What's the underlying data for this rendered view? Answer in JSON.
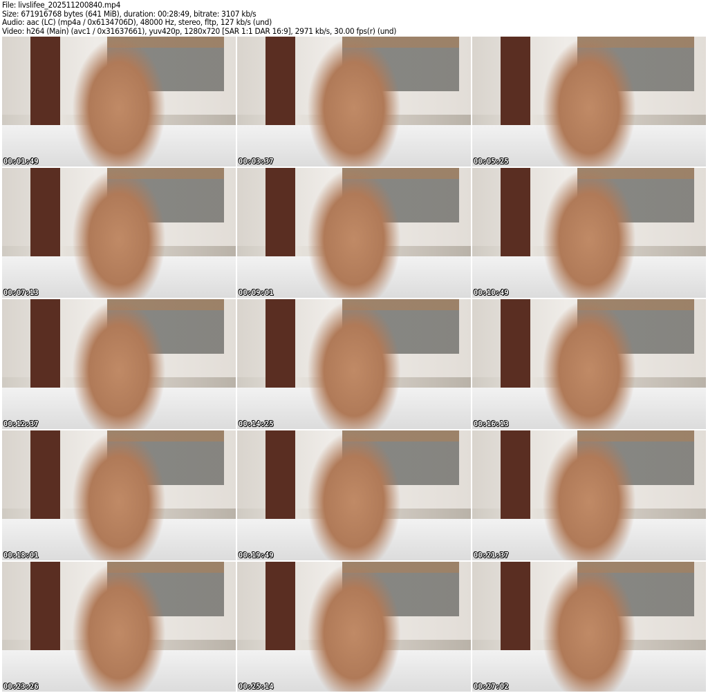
{
  "header": {
    "file": "File: livslifee_202511200840.mp4",
    "size": "Size: 671916768 bytes (641 MiB), duration: 00:28:49, bitrate: 3107 kb/s",
    "audio": "Audio: aac (LC) (mp4a / 0x6134706D), 48000 Hz, stereo, fltp, 127 kb/s (und)",
    "video": "Video: h264 (Main) (avc1 / 0x31637661), yuv420p, 1280x720 [SAR 1:1 DAR 16:9], 2971 kb/s, 30.00 fps(r) (und)"
  },
  "thumbnails": [
    {
      "timestamp": "00:01:49"
    },
    {
      "timestamp": "00:03:37"
    },
    {
      "timestamp": "00:05:25"
    },
    {
      "timestamp": "00:07:13"
    },
    {
      "timestamp": "00:09:01"
    },
    {
      "timestamp": "00:10:49"
    },
    {
      "timestamp": "00:12:37"
    },
    {
      "timestamp": "00:14:25"
    },
    {
      "timestamp": "00:16:13"
    },
    {
      "timestamp": "00:18:01"
    },
    {
      "timestamp": "00:19:49"
    },
    {
      "timestamp": "00:21:37"
    },
    {
      "timestamp": "00:23:26"
    },
    {
      "timestamp": "00:25:14"
    },
    {
      "timestamp": "00:27:02"
    }
  ]
}
